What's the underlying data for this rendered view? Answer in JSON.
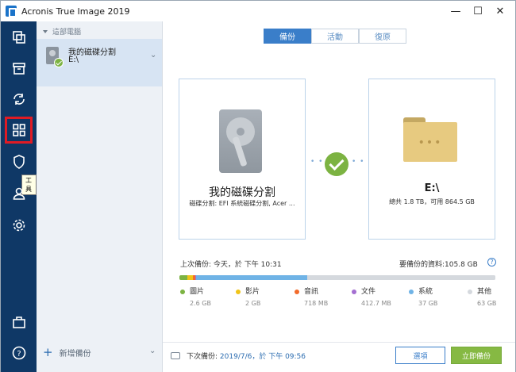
{
  "window": {
    "title": "Acronis True Image 2019",
    "min_glyph": "—",
    "max_glyph": "☐",
    "close_glyph": "✕"
  },
  "sidebar": {
    "items": [
      {
        "name": "backup",
        "icon": "copy-icon"
      },
      {
        "name": "archive",
        "icon": "archive-icon"
      },
      {
        "name": "sync",
        "icon": "sync-icon"
      },
      {
        "name": "tools",
        "icon": "grid-icon",
        "selected": true
      },
      {
        "name": "protection",
        "icon": "shield-icon"
      },
      {
        "name": "account",
        "icon": "person-icon"
      },
      {
        "name": "settings",
        "icon": "gear-icon"
      },
      {
        "name": "store",
        "icon": "briefcase-icon"
      },
      {
        "name": "help",
        "icon": "help-icon"
      }
    ],
    "tooltip": "工具",
    "accent_color": "#e01b24",
    "bg_color": "#0f3866"
  },
  "source_panel": {
    "header": "這部電腦",
    "item_name": "我的磁碟分割",
    "item_sub": "E:\\",
    "expand_glyph": "⌄",
    "add_backup_plus": "+",
    "add_backup_label": "新增備份",
    "add_backup_chev": "⌄"
  },
  "main": {
    "tabs": [
      {
        "label": "備份",
        "active": true
      },
      {
        "label": "活動",
        "active": false
      },
      {
        "label": "復原",
        "active": false
      }
    ],
    "source_card": {
      "title": "我的磁碟分割",
      "subtitle": "磁碟分割: EFI 系統磁碟分割, Acer ..."
    },
    "dest_card": {
      "title": "E:\\",
      "subtitle": "總共 1.8 TB，可用 864.5 GB"
    },
    "link_dots": "• • •",
    "last_backup": "上次備份: 今天，於 下午 10:31",
    "data_size": "要備份的資料:105.8 GB",
    "help_glyph": "?",
    "usage": {
      "total_gb": 105.8,
      "categories": [
        {
          "label": "圖片",
          "value": "2.6 GB",
          "gb": 2.6,
          "color": "#7cb342"
        },
        {
          "label": "影片",
          "value": "2 GB",
          "gb": 2.0,
          "color": "#f0c419"
        },
        {
          "label": "音訊",
          "value": "718 MB",
          "gb": 0.7,
          "color": "#f26b2b"
        },
        {
          "label": "文件",
          "value": "412.7 MB",
          "gb": 0.4,
          "color": "#a46fd1"
        },
        {
          "label": "系統",
          "value": "37 GB",
          "gb": 37.0,
          "color": "#6fb3e6"
        },
        {
          "label": "其他",
          "value": "63 GB",
          "gb": 63.0,
          "color": "#d5d9de"
        }
      ]
    },
    "footer": {
      "next_backup_prefix": "下次備份:",
      "next_backup_value": "2019/7/6，於 下午 09:56",
      "options_label": "選項",
      "backup_now_label": "立即備份"
    }
  }
}
